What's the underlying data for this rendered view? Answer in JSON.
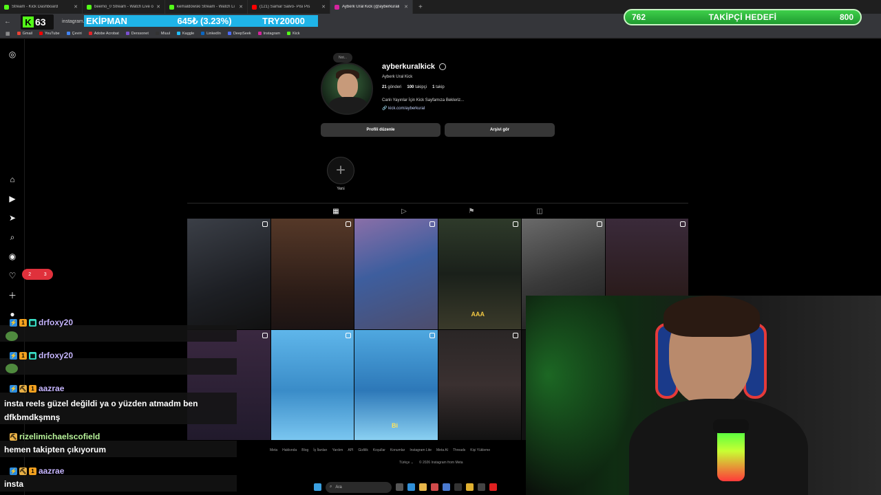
{
  "tabs": [
    {
      "label": "Stream - Kick Dashboard",
      "color": "#53fc18"
    },
    {
      "label": "beemo_0 Stream - Watch Live o",
      "color": "#53fc18"
    },
    {
      "label": "kemaldowski Stream - Watch Li",
      "color": "#53fc18"
    },
    {
      "label": "(121) Samar Salvo- Pisi Pis",
      "color": "#ff0000"
    },
    {
      "label": "Ayberk Ural Kick (@ayberkurali",
      "color": "#d6249f",
      "active": true
    }
  ],
  "address": {
    "url": "instagram.com"
  },
  "bookmarks": [
    {
      "label": "Gmail",
      "color": "#ea4335"
    },
    {
      "label": "YouTube",
      "color": "#ff0000"
    },
    {
      "label": "Çeviri",
      "color": "#4285f4"
    },
    {
      "label": "Adobe Acrobat",
      "color": "#e5252a"
    },
    {
      "label": "Derssonet",
      "color": "#7a4fd0"
    },
    {
      "label": "Miuul",
      "color": "#333333"
    },
    {
      "label": "Kaggle",
      "color": "#20beff"
    },
    {
      "label": "LinkedIn",
      "color": "#0a66c2"
    },
    {
      "label": "DeepSeek",
      "color": "#4d6bfe"
    },
    {
      "label": "Instagram",
      "color": "#d6249f"
    },
    {
      "label": "Kick",
      "color": "#53fc18"
    }
  ],
  "overlay": {
    "kick_count": "63",
    "ticker": {
      "item": "EKİPMAN",
      "price": "645₺ (3.23%)",
      "target": "TRY20000"
    },
    "goal": {
      "current": "762",
      "title": "TAKİPÇİ HEDEFİ",
      "target": "800",
      "progress_fraction": 0.9525
    }
  },
  "profile": {
    "note": "Not...",
    "username": "ayberkuralkick",
    "full_name": "Ayberk Ural Kick",
    "posts_count": "21",
    "posts_label": "gönderi",
    "followers_count": "100",
    "followers_label": "takipçi",
    "following_count": "1",
    "following_label": "takip",
    "bio": "Canlı Yayınlar İçin Kick Sayfamıza Bekleriz...",
    "link": "kick.com/ayberkural",
    "edit_button": "Profili düzenle",
    "archive_button": "Arşivi gör",
    "new_highlight": "Yeni"
  },
  "grid_overlays": {
    "aaa": "AAA",
    "bi": "Bi"
  },
  "footer": {
    "links": [
      "Meta",
      "Hakkında",
      "Blog",
      "İş İlanları",
      "Yardım",
      "API",
      "Gizlilik",
      "Koşullar",
      "Konumlar",
      "Instagram Lite",
      "Meta AI",
      "Threads",
      "Kişi Yükleme"
    ],
    "language": "Türkçe",
    "copyright": "© 2026 Instagram from Meta"
  },
  "taskbar": {
    "search_placeholder": "Ara"
  },
  "notifications": {
    "comments": "2",
    "likes": "3"
  },
  "chat": [
    {
      "user": "drfoxy20",
      "text": ""
    },
    {
      "user": "drfoxy20",
      "text": ""
    },
    {
      "user": "aazrae",
      "text": "insta reels güzel değildi ya o yüzden atmadm ben dfkbmdkşmnş"
    },
    {
      "user": "rizelimichaelscofield",
      "text": "hemen takipten çıkıyorum"
    },
    {
      "user": "aazrae",
      "text": "insta"
    }
  ]
}
